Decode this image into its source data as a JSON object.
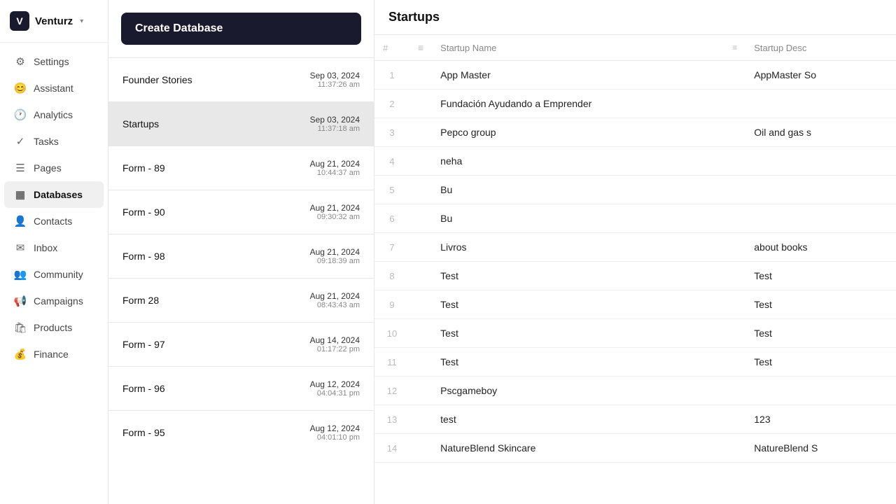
{
  "app": {
    "logo_letter": "V",
    "logo_name": "Venturz",
    "logo_chevron": "▾"
  },
  "sidebar": {
    "items": [
      {
        "id": "settings",
        "label": "Settings",
        "icon": "⚙"
      },
      {
        "id": "assistant",
        "label": "Assistant",
        "icon": "😊"
      },
      {
        "id": "analytics",
        "label": "Analytics",
        "icon": "🕐"
      },
      {
        "id": "tasks",
        "label": "Tasks",
        "icon": "✓"
      },
      {
        "id": "pages",
        "label": "Pages",
        "icon": "☰"
      },
      {
        "id": "databases",
        "label": "Databases",
        "icon": "▦",
        "active": true
      },
      {
        "id": "contacts",
        "label": "Contacts",
        "icon": "👤"
      },
      {
        "id": "inbox",
        "label": "Inbox",
        "icon": "✉"
      },
      {
        "id": "community",
        "label": "Community",
        "icon": "👥"
      },
      {
        "id": "campaigns",
        "label": "Campaigns",
        "icon": "📢"
      },
      {
        "id": "products",
        "label": "Products",
        "icon": "🛍"
      },
      {
        "id": "finance",
        "label": "Finance",
        "icon": "💰"
      }
    ]
  },
  "middle": {
    "create_button_label": "Create Database",
    "databases": [
      {
        "name": "Founder Stories",
        "date": "Sep 03, 2024",
        "time": "11:37:26 am"
      },
      {
        "name": "Startups",
        "date": "Sep 03, 2024",
        "time": "11:37:18 am",
        "active": true
      },
      {
        "name": "Form - 89",
        "date": "Aug 21, 2024",
        "time": "10:44:37 am"
      },
      {
        "name": "Form - 90",
        "date": "Aug 21, 2024",
        "time": "09:30:32 am"
      },
      {
        "name": "Form - 98",
        "date": "Aug 21, 2024",
        "time": "09:18:39 am"
      },
      {
        "name": "Form 28",
        "date": "Aug 21, 2024",
        "time": "08:43:43 am"
      },
      {
        "name": "Form - 97",
        "date": "Aug 14, 2024",
        "time": "01:17:22 pm"
      },
      {
        "name": "Form - 96",
        "date": "Aug 12, 2024",
        "time": "04:04:31 pm"
      },
      {
        "name": "Form - 95",
        "date": "Aug 12, 2024",
        "time": "04:01:10 pm"
      }
    ]
  },
  "main": {
    "title": "Startups",
    "columns": {
      "num": "#",
      "menu": "≡",
      "startup_name": "Startup Name",
      "startup_desc": "Startup Desc"
    },
    "rows": [
      {
        "num": 1,
        "name": "App Master",
        "desc": "AppMaster So"
      },
      {
        "num": 2,
        "name": "Fundación Ayudando a Emprender",
        "desc": ""
      },
      {
        "num": 3,
        "name": "Pepco group",
        "desc": "Oil and gas s"
      },
      {
        "num": 4,
        "name": "neha",
        "desc": ""
      },
      {
        "num": 5,
        "name": "Bu",
        "desc": ""
      },
      {
        "num": 6,
        "name": "Bu",
        "desc": ""
      },
      {
        "num": 7,
        "name": "Livros",
        "desc": "about books"
      },
      {
        "num": 8,
        "name": "Test",
        "desc": "Test"
      },
      {
        "num": 9,
        "name": "Test",
        "desc": "Test"
      },
      {
        "num": 10,
        "name": "Test",
        "desc": "Test"
      },
      {
        "num": 11,
        "name": "Test",
        "desc": "Test"
      },
      {
        "num": 12,
        "name": "Pscgameboy",
        "desc": ""
      },
      {
        "num": 13,
        "name": "test",
        "desc": "123"
      },
      {
        "num": 14,
        "name": "NatureBlend Skincare",
        "desc": "NatureBlend S"
      }
    ]
  }
}
